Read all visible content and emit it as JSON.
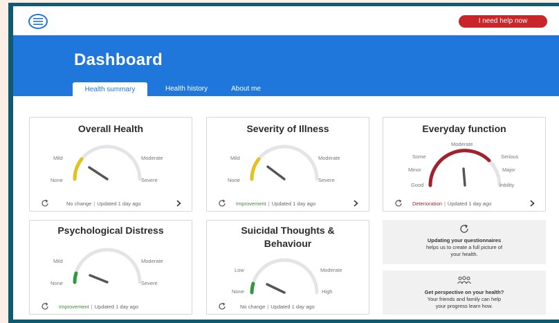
{
  "header": {
    "help_button": "I need help now"
  },
  "hero": {
    "title": "Dashboard"
  },
  "tabs": [
    {
      "label": "Health summary",
      "active": true
    },
    {
      "label": "Health history",
      "active": false
    },
    {
      "label": "About me",
      "active": false
    }
  ],
  "cards": [
    {
      "title": "Overall Health",
      "labels": {
        "left_top": "Mild",
        "left_bottom": "None",
        "right_top": "Moderate",
        "right_bottom": "Severe"
      },
      "status": "No change",
      "updated": "Updated 1 day ago",
      "level": "none-mild",
      "color": "#e2c21b"
    },
    {
      "title": "Severity of Illness",
      "labels": {
        "left_top": "Mild",
        "left_bottom": "None",
        "right_top": "Moderate",
        "right_bottom": "Severe"
      },
      "status": "Improvement",
      "updated": "Updated 1 day ago",
      "level": "none-mild",
      "color": "#e2c21b"
    },
    {
      "title": "Everyday function",
      "labels": {
        "top": "Moderate",
        "l1": "Some",
        "l2": "Minor",
        "l3": "Good",
        "r1": "Serious",
        "r2": "Major",
        "r3": "Inbility"
      },
      "status": "Deterioration",
      "updated": "Updated 1 day ago",
      "level": "moderate",
      "color": "#a3202d"
    },
    {
      "title": "Psychological Distress",
      "labels": {
        "left_top": "Mild",
        "left_bottom": "None",
        "right_top": "Moderate",
        "right_bottom": "Severe"
      },
      "status": "Improvement",
      "updated": "Updated 1 day ago",
      "level": "none",
      "color": "#2f9a3d"
    },
    {
      "title_line1": "Suicidal Thoughts &",
      "title_line2": "Behaviour",
      "labels": {
        "left_top": "Low",
        "left_bottom": "None",
        "right_top": "Moderate",
        "right_bottom": "High"
      },
      "status": "No change",
      "updated": "Updated 1 day ago",
      "level": "none",
      "color": "#2f9a3d"
    }
  ],
  "info": [
    {
      "title": "Updating your questionnaires",
      "body1": "helps us to create a full picture of",
      "body2": "your health.",
      "icon": "refresh-icon"
    },
    {
      "title": "Get perspective on your health?",
      "body1": "Your friends and family can help",
      "body2": "your progress learn how.",
      "icon": "people-icon"
    }
  ],
  "colors": {
    "primary": "#1f77dc",
    "danger": "#c9262b",
    "track": "#e4e4e8",
    "needle": "#555555"
  }
}
